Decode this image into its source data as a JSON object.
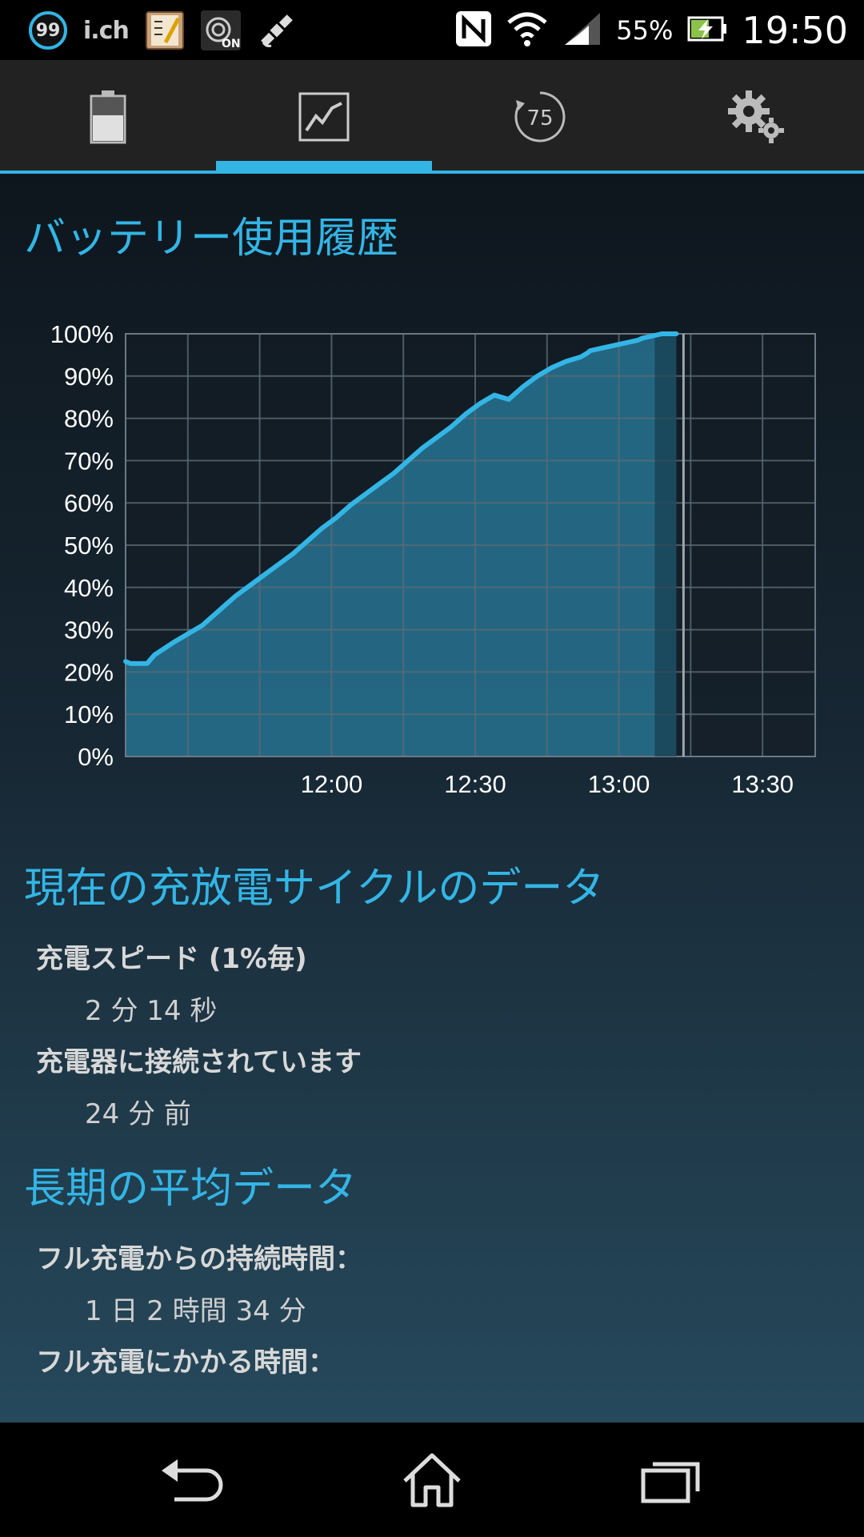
{
  "status_bar": {
    "notification_badge": "99",
    "ich_label": "i.ch",
    "battery_percent": "55%",
    "clock": "19:50",
    "icons": [
      "counter-99-icon",
      "ich-icon",
      "notepad-app-icon",
      "wifi-on-icon",
      "satellite-icon",
      "nfc-icon",
      "wifi-signal-icon",
      "cell-signal-icon",
      "battery-charging-icon"
    ]
  },
  "tabs": [
    {
      "icon": "battery-icon",
      "selected": false
    },
    {
      "icon": "chart-icon",
      "selected": true
    },
    {
      "icon": "gauge-75-icon",
      "label": "75",
      "selected": false
    },
    {
      "icon": "settings-gears-icon",
      "selected": false
    }
  ],
  "history": {
    "title": "バッテリー使用履歴"
  },
  "chart_data": {
    "type": "area",
    "title": "",
    "xlabel": "",
    "ylabel": "",
    "x_tick_labels": [
      "12:00",
      "12:30",
      "13:00",
      "13:30"
    ],
    "x_tick_minutes": [
      720,
      750,
      780,
      810
    ],
    "xlim_minutes": [
      677,
      821
    ],
    "y_tick_labels": [
      "100%",
      "90%",
      "80%",
      "70%",
      "60%",
      "50%",
      "40%",
      "30%",
      "20%",
      "10%",
      "0%"
    ],
    "ylim": [
      0,
      100
    ],
    "grid": true,
    "now_marker_minutes": 793.5,
    "series": [
      {
        "x": [
          677,
          678,
          680,
          681.5,
          683,
          685,
          687,
          690,
          693,
          695,
          696,
          698,
          700,
          703,
          706,
          709,
          712,
          715,
          718,
          721,
          724,
          727,
          730,
          733,
          736,
          739,
          742,
          745,
          748,
          751,
          754,
          757,
          760,
          763,
          766,
          769,
          772,
          773.5,
          774,
          776,
          778,
          780,
          782,
          784,
          785,
          787,
          789,
          790,
          791,
          792
        ],
        "values": [
          22.5,
          22,
          22,
          22,
          24,
          25.5,
          27,
          29,
          31,
          33,
          34,
          36,
          38,
          40.5,
          43,
          45.5,
          48,
          51,
          54,
          56.5,
          59.5,
          62,
          64.5,
          67,
          70,
          73,
          75.5,
          78,
          81,
          83.5,
          85.5,
          84.5,
          87.5,
          90,
          92,
          93.5,
          94.5,
          95.5,
          96,
          96.5,
          97,
          97.5,
          98,
          98.5,
          99,
          99.5,
          100,
          100,
          100,
          100
        ]
      }
    ]
  },
  "current_cycle": {
    "title": "現在の充放電サイクルのデータ",
    "items": [
      {
        "label": "充電スピード (1%毎)",
        "value": "2 分 14 秒"
      },
      {
        "label": "充電器に接続されています",
        "value": "24 分 前"
      }
    ]
  },
  "long_term": {
    "title": "長期の平均データ",
    "items": [
      {
        "label": "フル充電からの持続時間：",
        "value": "1 日 2 時間 34 分"
      },
      {
        "label": "フル充電にかかる時間：",
        "value": ""
      }
    ]
  },
  "nav_bar": {
    "buttons": [
      "back-icon",
      "home-icon",
      "recent-apps-icon"
    ]
  },
  "colors": {
    "accent": "#33b5e5",
    "fill": "#2a7fa0"
  }
}
